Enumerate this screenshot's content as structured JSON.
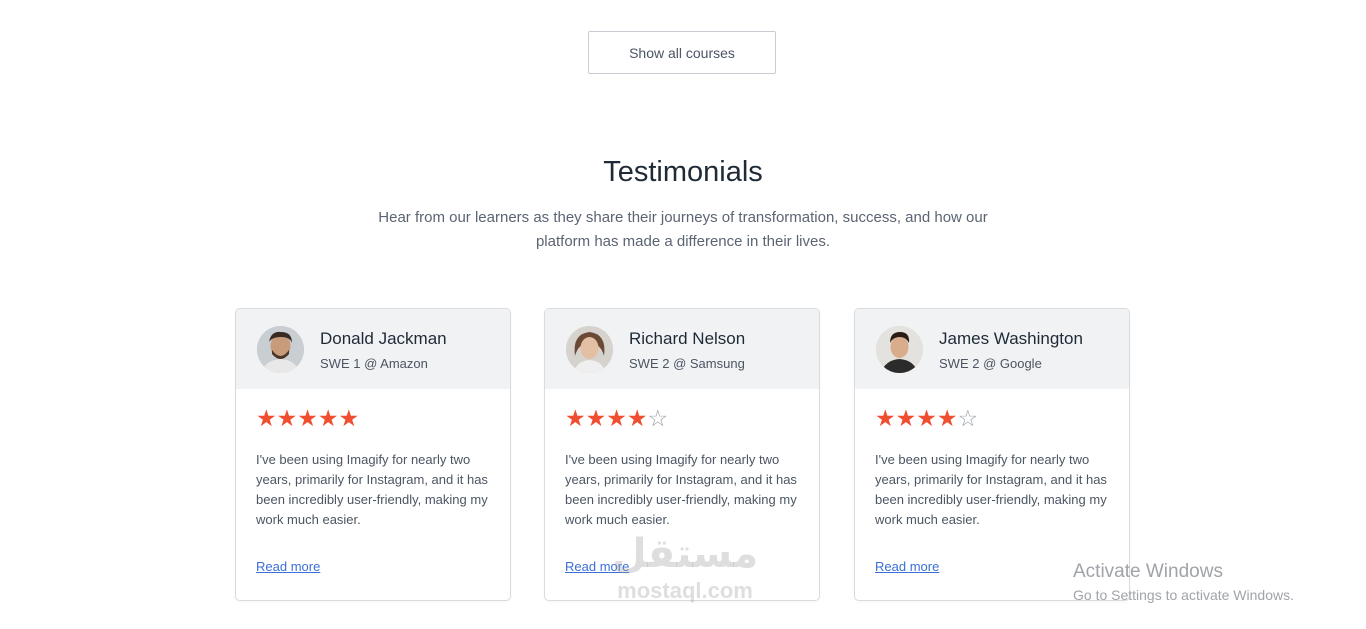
{
  "courses": {
    "show_all_label": "Show all courses"
  },
  "testimonials": {
    "title": "Testimonials",
    "subtitle": "Hear from our learners as they share their journeys of transformation, success, and how our platform has made a difference in their lives.",
    "cards": [
      {
        "name": "Donald Jackman",
        "role": "SWE 1 @ Amazon",
        "rating": 5,
        "max_rating": 5,
        "quote": "I've been using Imagify for nearly two years, primarily for Instagram, and it has been incredibly user-friendly, making my work much easier.",
        "link_label": "Read more",
        "avatar_icon": "avatar-photo"
      },
      {
        "name": "Richard Nelson",
        "role": "SWE 2 @ Samsung",
        "rating": 4,
        "max_rating": 5,
        "quote": "I've been using Imagify for nearly two years, primarily for Instagram, and it has been incredibly user-friendly, making my work much easier.",
        "link_label": "Read more",
        "avatar_icon": "avatar-photo"
      },
      {
        "name": "James Washington",
        "role": "SWE 2 @ Google",
        "rating": 4,
        "max_rating": 5,
        "quote": "I've been using Imagify for nearly two years, primarily for Instagram, and it has been incredibly user-friendly, making my work much easier.",
        "link_label": "Read more",
        "avatar_icon": "avatar-photo"
      }
    ]
  },
  "watermark": {
    "arabic": "مستقل",
    "latin": "mostaql.com"
  },
  "os_overlay": {
    "line1": "Activate Windows",
    "line2": "Go to Settings to activate Windows."
  },
  "colors": {
    "star_filled": "#f04e30",
    "star_empty": "#9aa0a8",
    "link": "#3b6fd8",
    "card_header_bg": "#f1f2f4"
  }
}
